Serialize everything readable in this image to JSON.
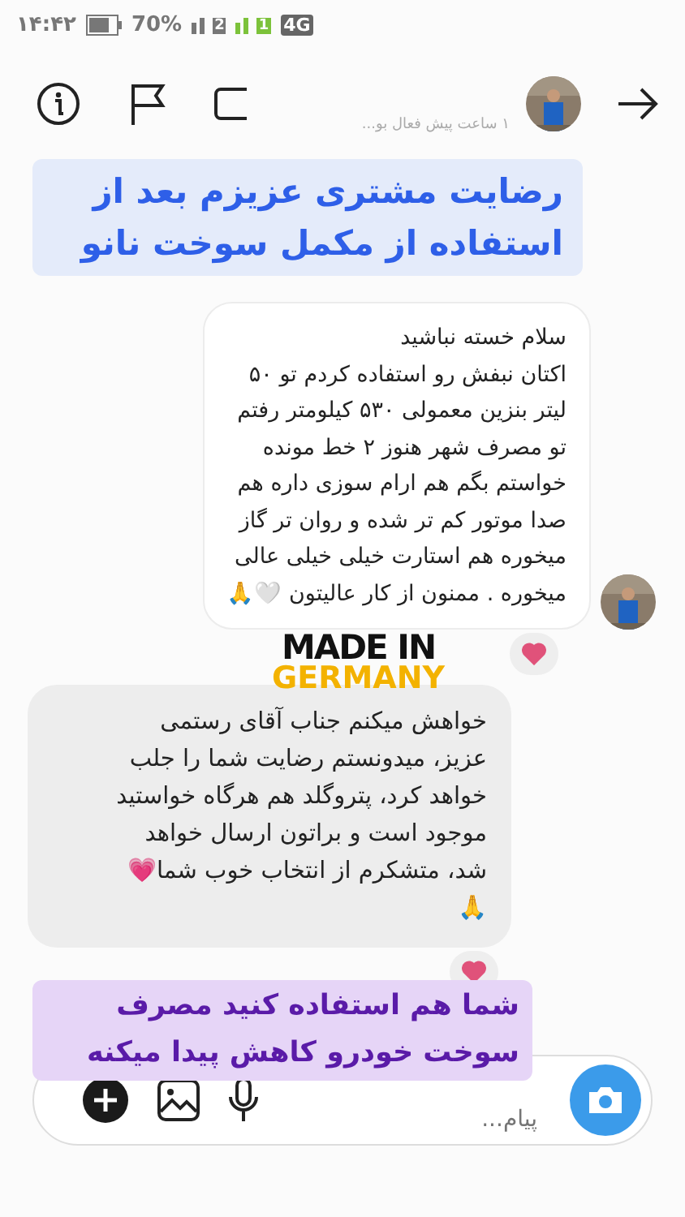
{
  "status_bar": {
    "time": "۱۴:۴۲",
    "battery": "70%",
    "sim_1": "2",
    "sim_2": "1",
    "network": "4G"
  },
  "header": {
    "status": "۱ ساعت پیش فعال بو..."
  },
  "caption_top": "رضایت مشتری عزیزم بعد از\nاستفاده از مکمل سوخت نانو",
  "messages": [
    {
      "kind": "received",
      "text": "سلام  خسته نباشید\nاکتان نبفش رو استفاده کردم تو ۵۰\nلیتر بنزین معمولی  ۵۳۰ کیلومتر رفتم\nتو مصرف شهر هنوز ۲ خط مونده\nخواستم بگم هم ارام سوزی داره هم\nصدا موتور کم تر شده و روان تر گاز\nمیخوره هم استارت خیلی خیلی عالی\nمیخوره . ممنون از کار عالیتون 🤍🙏",
      "liked": true
    },
    {
      "kind": "sent",
      "text": "خواهش میکنم جناب آقای رستمی\nعزیز، میدونستم رضایت شما را جلب\nخواهد کرد، پتروگلد هم هرگاه خواستید\nموجود است و براتون ارسال خواهد\nشد، متشکرم از انتخاب خوب شما💗\n🙏",
      "liked": true
    }
  ],
  "badge": {
    "line_1": "MADE IN",
    "line_2": "GERMANY"
  },
  "caption_bottom": "شما هم استفاده کنید مصرف\nسوخت خودرو کاهش پیدا میکنه",
  "composer": {
    "placeholder": "پیام..."
  }
}
